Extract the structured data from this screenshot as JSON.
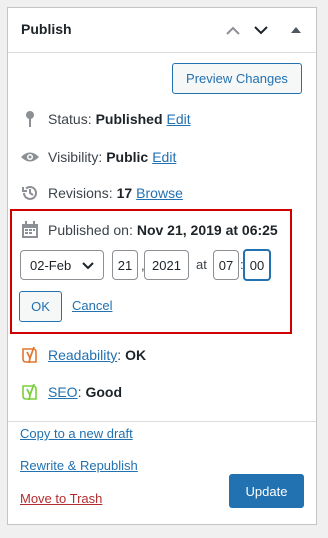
{
  "header": {
    "title": "Publish"
  },
  "actions": {
    "preview_label": "Preview Changes"
  },
  "status": {
    "label": "Status:",
    "value": "Published",
    "edit": "Edit"
  },
  "visibility": {
    "label": "Visibility:",
    "value": "Public",
    "edit": "Edit"
  },
  "revisions": {
    "label": "Revisions:",
    "value": "17",
    "link": "Browse"
  },
  "published_on": {
    "label": "Published on:",
    "value": "Nov 21, 2019 at 06:25",
    "month_selected": "02-Feb",
    "day": "21",
    "year": "2021",
    "comma": ",",
    "at": "at",
    "hour": "07",
    "colon": ":",
    "minute": "00",
    "ok": "OK",
    "cancel": "Cancel"
  },
  "readability": {
    "label": "Readability",
    "value": "OK",
    "colon": ":",
    "color": "#e27730"
  },
  "seo": {
    "label": "SEO",
    "value": "Good",
    "colon": ":",
    "color": "#7ad03a"
  },
  "links": {
    "copy_draft": "Copy to a new draft",
    "rewrite": "Rewrite & Republish",
    "trash": "Move to Trash"
  },
  "update_label": "Update",
  "colors": {
    "primary": "#2271b1",
    "danger": "#b32d2e",
    "highlight_border": "#d00000"
  }
}
